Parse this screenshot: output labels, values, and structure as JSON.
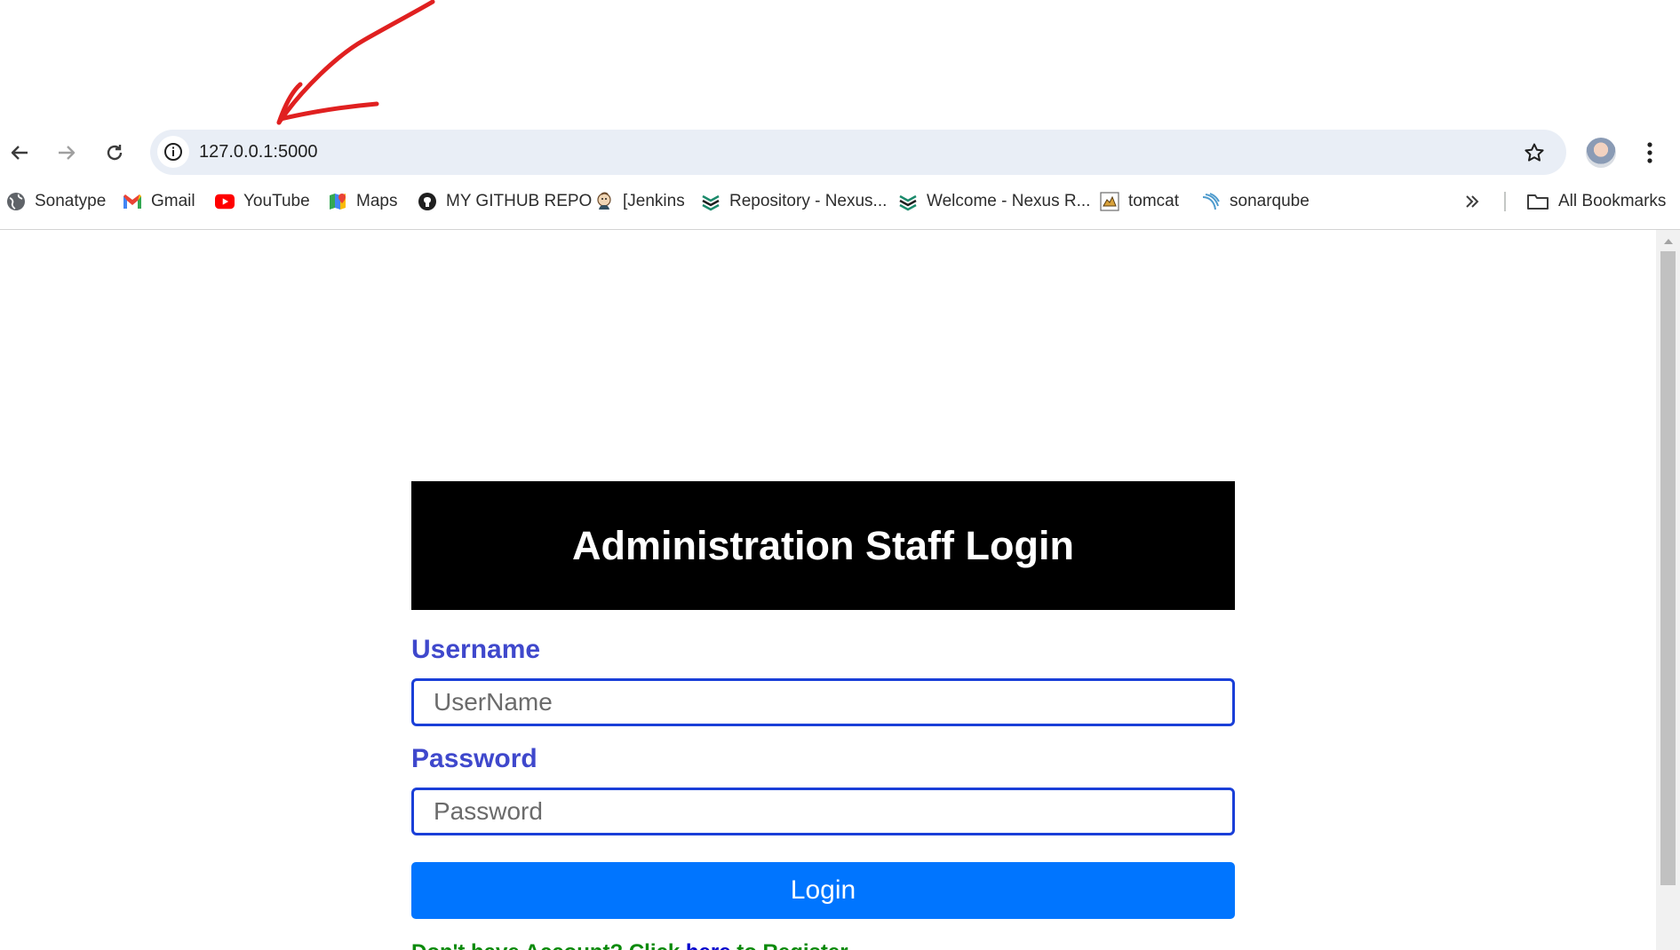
{
  "browser": {
    "url": "127.0.0.1:5000",
    "bookmarks": [
      {
        "label": "Sonatype",
        "icon": "globe-icon"
      },
      {
        "label": "Gmail",
        "icon": "gmail-icon"
      },
      {
        "label": "YouTube",
        "icon": "youtube-icon"
      },
      {
        "label": "Maps",
        "icon": "maps-icon"
      },
      {
        "label": "MY GITHUB REPO",
        "icon": "github-icon"
      },
      {
        "label": "[Jenkins",
        "icon": "jenkins-icon"
      },
      {
        "label": "Repository - Nexus...",
        "icon": "nexus-icon"
      },
      {
        "label": "Welcome - Nexus R...",
        "icon": "nexus-icon"
      },
      {
        "label": "tomcat",
        "icon": "tomcat-icon"
      },
      {
        "label": "sonarqube",
        "icon": "sonarqube-icon"
      }
    ],
    "all_bookmarks_label": "All Bookmarks"
  },
  "page": {
    "header_title": "Administration Staff Login",
    "username_label": "Username",
    "username_placeholder": "UserName",
    "password_label": "Password",
    "password_placeholder": "Password",
    "login_button": "Login",
    "register_prefix": "Don't have Account? Click ",
    "register_link": "here",
    "register_suffix": " to Register"
  },
  "colors": {
    "header_bg": "#000000",
    "label": "#3f48cc",
    "input_border": "#1a3fd8",
    "button_bg": "#0075ff",
    "register_text": "#0a8a0a",
    "register_link": "#0000cc",
    "annotation": "#e02020"
  }
}
